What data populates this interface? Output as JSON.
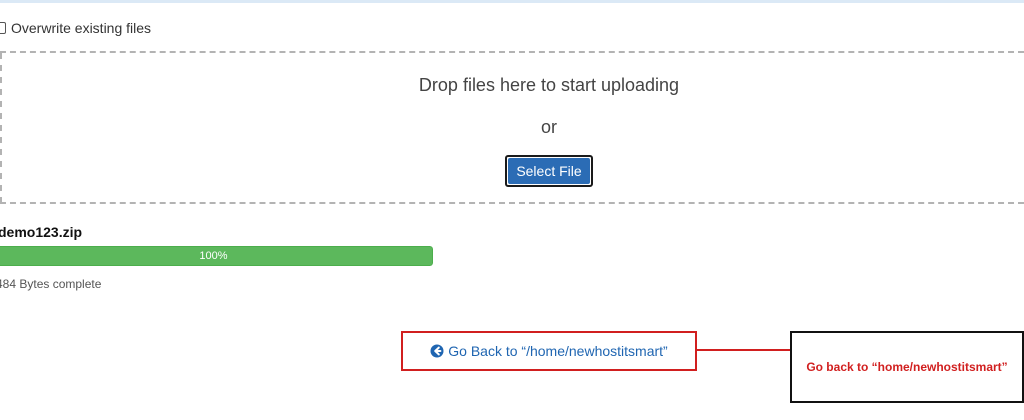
{
  "options": {
    "overwrite_label": "Overwrite existing files",
    "overwrite_checked": false
  },
  "dropzone": {
    "prompt": "Drop files here to start uploading",
    "or_text": "or",
    "select_button_label": "Select File"
  },
  "upload": {
    "file_name": "demo123.zip",
    "progress_label": "100%",
    "progress_fraction": 1.0,
    "status_text": "484 Bytes complete"
  },
  "navigation": {
    "go_back_label": "Go Back to “/home/newhostitsmart”",
    "icon": "circle-arrow-left-icon"
  },
  "annotation": {
    "callout_text": "Go back to “home/newhostitsmart”"
  },
  "colors": {
    "progress_green": "#5cb85c",
    "button_blue": "#2b6cb5",
    "link_blue": "#1f65b1",
    "highlight_red": "#d11f1f"
  }
}
